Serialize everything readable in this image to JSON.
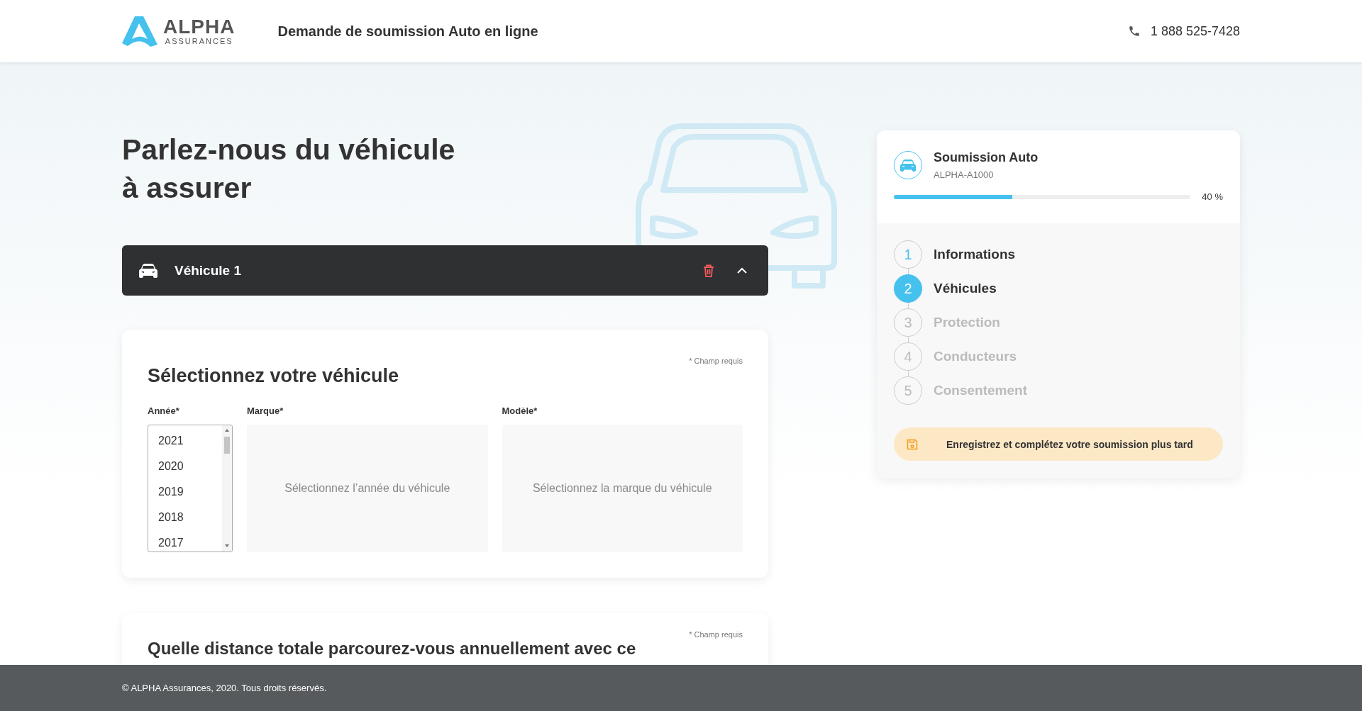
{
  "header": {
    "logo": {
      "name": "ALPHA",
      "tagline": "ASSURANCES"
    },
    "title": "Demande de soumission Auto en ligne",
    "phone": "1 888 525-7428"
  },
  "page_title": [
    "Parlez-nous du véhicule",
    "à assurer"
  ],
  "vehicle_bar": {
    "label": "Véhicule 1",
    "expanded": true
  },
  "vehicle_form": {
    "title": "Sélectionnez votre véhicule",
    "required_note": "* Champ requis",
    "fields": [
      {
        "kind": "listbox",
        "label": "Année*",
        "options": [
          "2021",
          "2020",
          "2019",
          "2018",
          "2017"
        ]
      },
      {
        "kind": "placeholder",
        "label": "Marque*",
        "placeholder": "Sélectionnez l’année du véhicule"
      },
      {
        "kind": "placeholder",
        "label": "Modèle*",
        "placeholder": "Sélectionnez la marque du véhicule"
      }
    ]
  },
  "distance_form": {
    "title": "Quelle distance totale parcourez-vous annuellement avec ce",
    "required_note": "* Champ requis"
  },
  "summary": {
    "title": "Soumission Auto",
    "reference": "ALPHA-A1000",
    "progress": {
      "level": 0.4,
      "reading": "40 %"
    },
    "steps": [
      {
        "number": "1",
        "label": "Informations",
        "completed": true,
        "selected": false
      },
      {
        "number": "2",
        "label": "Véhicules",
        "completed": false,
        "selected": true
      },
      {
        "number": "3",
        "label": "Protection",
        "completed": false,
        "selected": false
      },
      {
        "number": "4",
        "label": "Conducteurs",
        "completed": false,
        "selected": false
      },
      {
        "number": "5",
        "label": "Consentement",
        "completed": false,
        "selected": false
      }
    ],
    "save_button": "Enregistrez et complétez votre soumission plus tard"
  },
  "footer": "© ALPHA Assurances, 2020. Tous droits réservés."
}
